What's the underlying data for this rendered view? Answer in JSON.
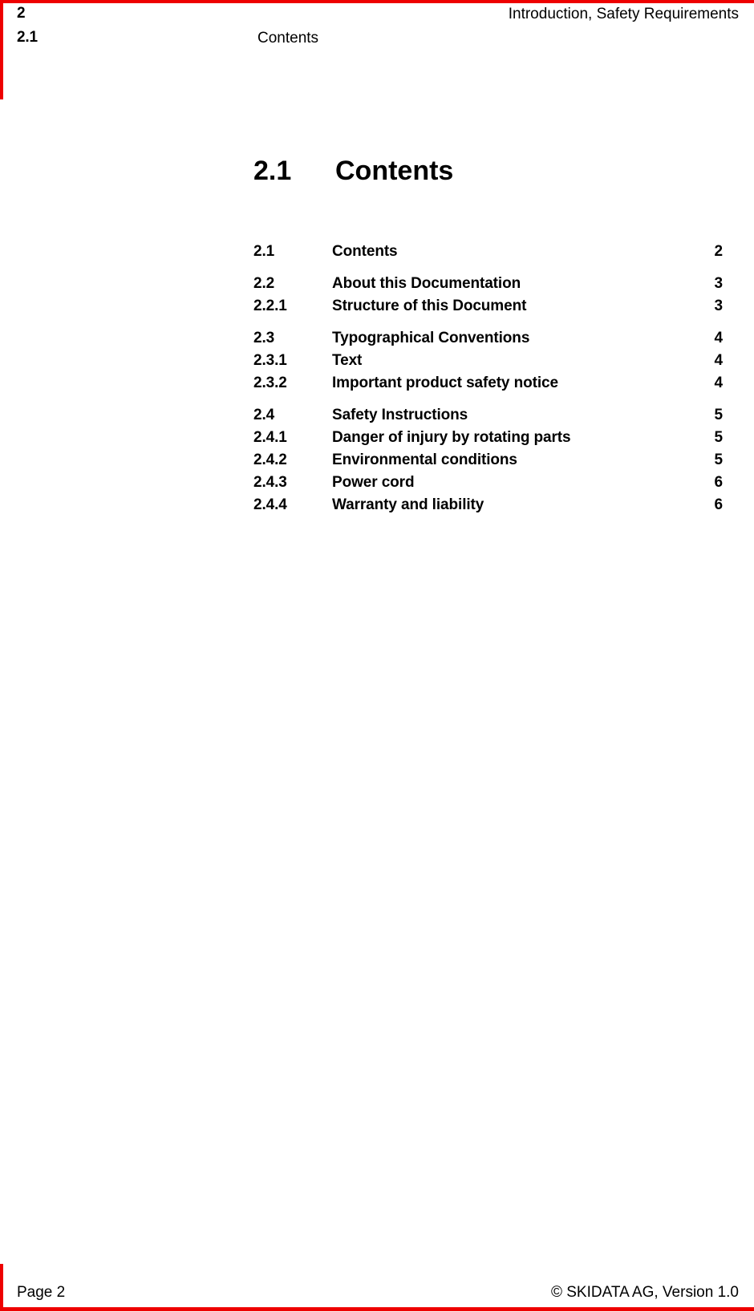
{
  "theme": {
    "rule_color": "#ee0000",
    "text_color": "#000000",
    "background": "#ffffff"
  },
  "header": {
    "chapter_number": "2",
    "chapter_title": "Introduction, Safety Requirements",
    "section_number": "2.1",
    "section_title": "Contents"
  },
  "heading": {
    "number": "2.1",
    "title": "Contents"
  },
  "toc": {
    "entries": [
      {
        "number": "2.1",
        "title": "Contents",
        "page": "2",
        "group_start": true
      },
      {
        "number": "2.2",
        "title": "About this Documentation",
        "page": "3",
        "group_start": true
      },
      {
        "number": "2.2.1",
        "title": "Structure of this Document",
        "page": "3",
        "group_start": false
      },
      {
        "number": "2.3",
        "title": "Typographical Conventions",
        "page": "4",
        "group_start": true
      },
      {
        "number": "2.3.1",
        "title": "Text",
        "page": "4",
        "group_start": false
      },
      {
        "number": "2.3.2",
        "title": "Important product safety notice",
        "page": "4",
        "group_start": false
      },
      {
        "number": "2.4",
        "title": "Safety Instructions",
        "page": "5",
        "group_start": true
      },
      {
        "number": "2.4.1",
        "title": "Danger of injury by rotating parts",
        "page": "5",
        "group_start": false
      },
      {
        "number": "2.4.2",
        "title": "Environmental conditions",
        "page": "5",
        "group_start": false
      },
      {
        "number": "2.4.3",
        "title": "Power cord",
        "page": "6",
        "group_start": false
      },
      {
        "number": "2.4.4",
        "title": "Warranty and liability",
        "page": "6",
        "group_start": false
      }
    ]
  },
  "footer": {
    "page_label": "Page 2",
    "copyright": "© SKIDATA AG, Version 1.0"
  }
}
